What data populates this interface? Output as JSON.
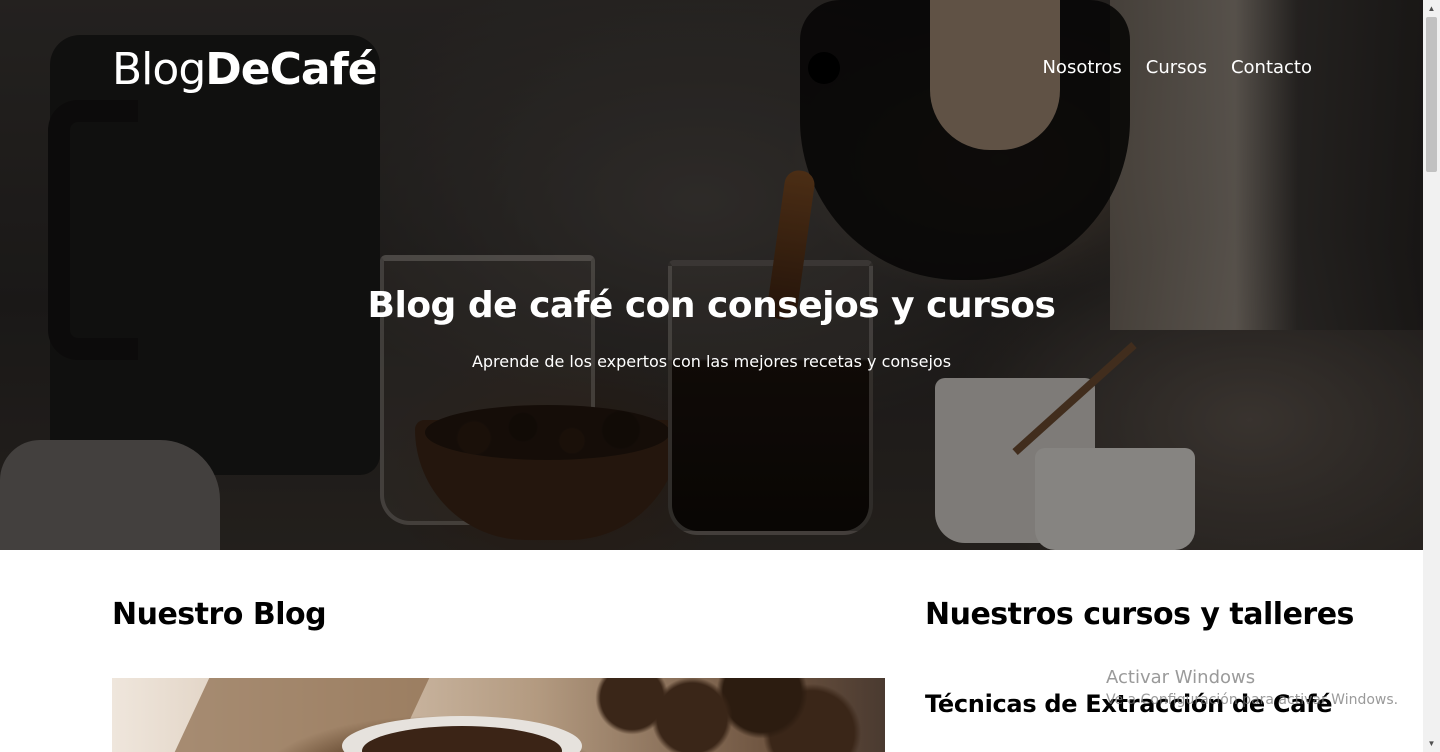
{
  "header": {
    "logo_light": "Blog",
    "logo_bold": "DeCafé",
    "nav": [
      "Nosotros",
      "Cursos",
      "Contacto"
    ]
  },
  "hero": {
    "title": "Blog de café con consejos y cursos",
    "subtitle": "Aprende de los expertos con las mejores recetas y consejos"
  },
  "blog": {
    "title": "Nuestro Blog"
  },
  "courses": {
    "title": "Nuestros cursos y talleres",
    "items": [
      "Técnicas de Extracción de Café"
    ]
  },
  "watermark": {
    "line1": "Activar Windows",
    "line2": "Ve a Configuración para activar Windows."
  },
  "colors": {
    "text": "#000000",
    "hero_text": "#ffffff",
    "background": "#ffffff"
  }
}
